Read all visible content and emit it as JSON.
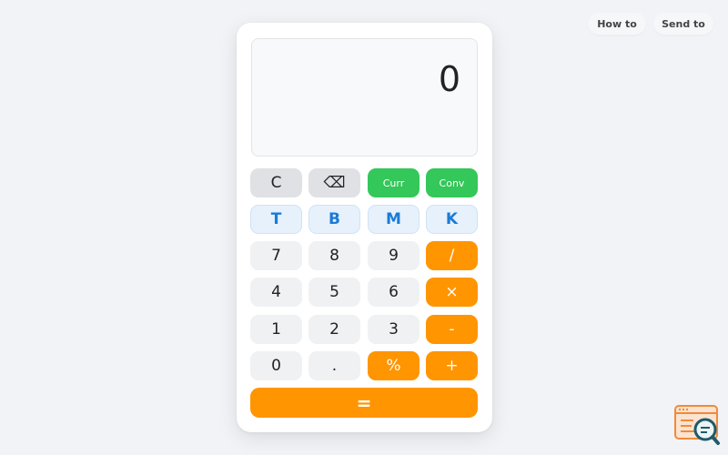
{
  "header": {
    "how_to_label": "How to",
    "send_to_label": "Send to"
  },
  "display": {
    "value": "0"
  },
  "keys": {
    "clear": "C",
    "backspace": "⌫",
    "currency": "Curr",
    "convert": "Conv",
    "thousand": "T",
    "billion": "B",
    "million": "M",
    "kilo": "K",
    "seven": "7",
    "eight": "8",
    "nine": "9",
    "divide": "/",
    "four": "4",
    "five": "5",
    "six": "6",
    "multiply": "×",
    "one": "1",
    "two": "2",
    "three": "3",
    "minus": "-",
    "zero": "0",
    "decimal": ".",
    "percent": "%",
    "plus": "+",
    "equals": "="
  },
  "colors": {
    "accent_orange": "#ff9500",
    "accent_green": "#34c759",
    "accent_blue": "#1a7bd6",
    "background": "#f1f3f6"
  },
  "icons": {
    "corner": "search-code-icon"
  }
}
